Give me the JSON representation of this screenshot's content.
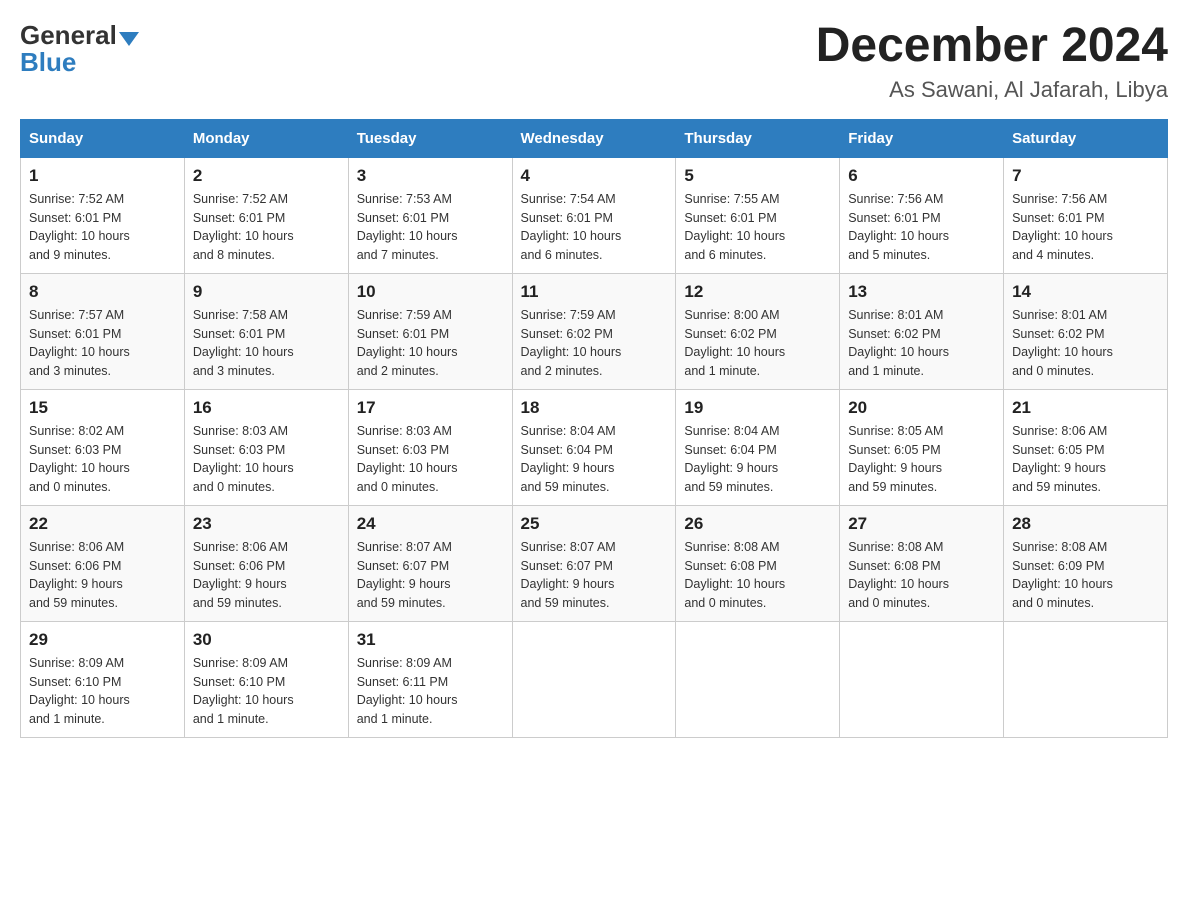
{
  "header": {
    "title": "December 2024",
    "subtitle": "As Sawani, Al Jafarah, Libya",
    "logo_general": "General",
    "logo_blue": "Blue"
  },
  "days_of_week": [
    "Sunday",
    "Monday",
    "Tuesday",
    "Wednesday",
    "Thursday",
    "Friday",
    "Saturday"
  ],
  "weeks": [
    [
      {
        "day": "1",
        "sunrise": "7:52 AM",
        "sunset": "6:01 PM",
        "daylight": "10 hours and 9 minutes."
      },
      {
        "day": "2",
        "sunrise": "7:52 AM",
        "sunset": "6:01 PM",
        "daylight": "10 hours and 8 minutes."
      },
      {
        "day": "3",
        "sunrise": "7:53 AM",
        "sunset": "6:01 PM",
        "daylight": "10 hours and 7 minutes."
      },
      {
        "day": "4",
        "sunrise": "7:54 AM",
        "sunset": "6:01 PM",
        "daylight": "10 hours and 6 minutes."
      },
      {
        "day": "5",
        "sunrise": "7:55 AM",
        "sunset": "6:01 PM",
        "daylight": "10 hours and 6 minutes."
      },
      {
        "day": "6",
        "sunrise": "7:56 AM",
        "sunset": "6:01 PM",
        "daylight": "10 hours and 5 minutes."
      },
      {
        "day": "7",
        "sunrise": "7:56 AM",
        "sunset": "6:01 PM",
        "daylight": "10 hours and 4 minutes."
      }
    ],
    [
      {
        "day": "8",
        "sunrise": "7:57 AM",
        "sunset": "6:01 PM",
        "daylight": "10 hours and 3 minutes."
      },
      {
        "day": "9",
        "sunrise": "7:58 AM",
        "sunset": "6:01 PM",
        "daylight": "10 hours and 3 minutes."
      },
      {
        "day": "10",
        "sunrise": "7:59 AM",
        "sunset": "6:01 PM",
        "daylight": "10 hours and 2 minutes."
      },
      {
        "day": "11",
        "sunrise": "7:59 AM",
        "sunset": "6:02 PM",
        "daylight": "10 hours and 2 minutes."
      },
      {
        "day": "12",
        "sunrise": "8:00 AM",
        "sunset": "6:02 PM",
        "daylight": "10 hours and 1 minute."
      },
      {
        "day": "13",
        "sunrise": "8:01 AM",
        "sunset": "6:02 PM",
        "daylight": "10 hours and 1 minute."
      },
      {
        "day": "14",
        "sunrise": "8:01 AM",
        "sunset": "6:02 PM",
        "daylight": "10 hours and 0 minutes."
      }
    ],
    [
      {
        "day": "15",
        "sunrise": "8:02 AM",
        "sunset": "6:03 PM",
        "daylight": "10 hours and 0 minutes."
      },
      {
        "day": "16",
        "sunrise": "8:03 AM",
        "sunset": "6:03 PM",
        "daylight": "10 hours and 0 minutes."
      },
      {
        "day": "17",
        "sunrise": "8:03 AM",
        "sunset": "6:03 PM",
        "daylight": "10 hours and 0 minutes."
      },
      {
        "day": "18",
        "sunrise": "8:04 AM",
        "sunset": "6:04 PM",
        "daylight": "9 hours and 59 minutes."
      },
      {
        "day": "19",
        "sunrise": "8:04 AM",
        "sunset": "6:04 PM",
        "daylight": "9 hours and 59 minutes."
      },
      {
        "day": "20",
        "sunrise": "8:05 AM",
        "sunset": "6:05 PM",
        "daylight": "9 hours and 59 minutes."
      },
      {
        "day": "21",
        "sunrise": "8:06 AM",
        "sunset": "6:05 PM",
        "daylight": "9 hours and 59 minutes."
      }
    ],
    [
      {
        "day": "22",
        "sunrise": "8:06 AM",
        "sunset": "6:06 PM",
        "daylight": "9 hours and 59 minutes."
      },
      {
        "day": "23",
        "sunrise": "8:06 AM",
        "sunset": "6:06 PM",
        "daylight": "9 hours and 59 minutes."
      },
      {
        "day": "24",
        "sunrise": "8:07 AM",
        "sunset": "6:07 PM",
        "daylight": "9 hours and 59 minutes."
      },
      {
        "day": "25",
        "sunrise": "8:07 AM",
        "sunset": "6:07 PM",
        "daylight": "9 hours and 59 minutes."
      },
      {
        "day": "26",
        "sunrise": "8:08 AM",
        "sunset": "6:08 PM",
        "daylight": "10 hours and 0 minutes."
      },
      {
        "day": "27",
        "sunrise": "8:08 AM",
        "sunset": "6:08 PM",
        "daylight": "10 hours and 0 minutes."
      },
      {
        "day": "28",
        "sunrise": "8:08 AM",
        "sunset": "6:09 PM",
        "daylight": "10 hours and 0 minutes."
      }
    ],
    [
      {
        "day": "29",
        "sunrise": "8:09 AM",
        "sunset": "6:10 PM",
        "daylight": "10 hours and 1 minute."
      },
      {
        "day": "30",
        "sunrise": "8:09 AM",
        "sunset": "6:10 PM",
        "daylight": "10 hours and 1 minute."
      },
      {
        "day": "31",
        "sunrise": "8:09 AM",
        "sunset": "6:11 PM",
        "daylight": "10 hours and 1 minute."
      },
      null,
      null,
      null,
      null
    ]
  ],
  "labels": {
    "sunrise": "Sunrise:",
    "sunset": "Sunset:",
    "daylight": "Daylight:"
  }
}
